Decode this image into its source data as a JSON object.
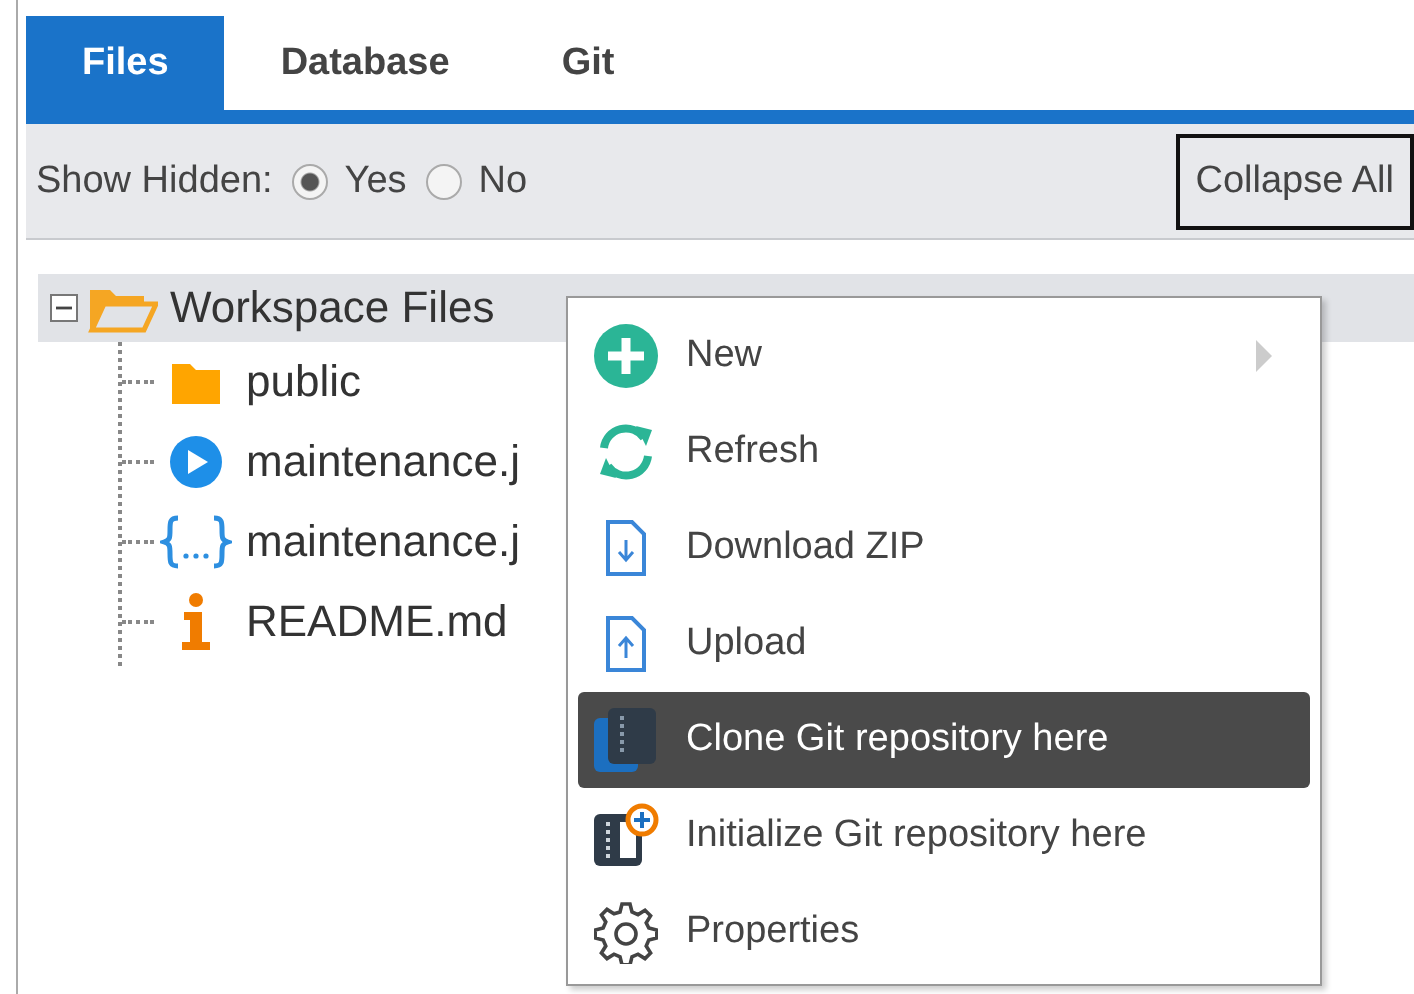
{
  "tabs": [
    {
      "label": "Files",
      "selected": true
    },
    {
      "label": "Database",
      "selected": false
    },
    {
      "label": "Git",
      "selected": false
    }
  ],
  "toolbar": {
    "label": "Show Hidden:",
    "options": [
      {
        "label": "Yes",
        "selected": true
      },
      {
        "label": "No",
        "selected": false
      }
    ],
    "button": "Collapse All"
  },
  "tree": [
    {
      "label": "Workspace Files",
      "kind": "folder-open",
      "expanded": true,
      "selected": true,
      "children": [
        {
          "label": "public",
          "kind": "folder",
          "selected": false
        },
        {
          "label": "maintenance.j",
          "kind": "script",
          "selected": false
        },
        {
          "label": "maintenance.j",
          "kind": "json",
          "selected": false
        },
        {
          "label": "README.md",
          "kind": "info",
          "selected": false
        }
      ]
    }
  ],
  "context_menu": [
    {
      "label": "New",
      "kind": "add",
      "submenu": true,
      "selected": false
    },
    {
      "label": "Refresh",
      "kind": "refresh",
      "submenu": false,
      "selected": false
    },
    {
      "label": "Download ZIP",
      "kind": "download",
      "submenu": false,
      "selected": false
    },
    {
      "label": "Upload",
      "kind": "upload",
      "submenu": false,
      "selected": false
    },
    {
      "label": "Clone Git repository here",
      "kind": "clone",
      "submenu": false,
      "selected": true
    },
    {
      "label": "Initialize Git repository here",
      "kind": "init",
      "submenu": false,
      "selected": false
    },
    {
      "label": "Properties",
      "kind": "settings",
      "submenu": false,
      "selected": false
    }
  ]
}
